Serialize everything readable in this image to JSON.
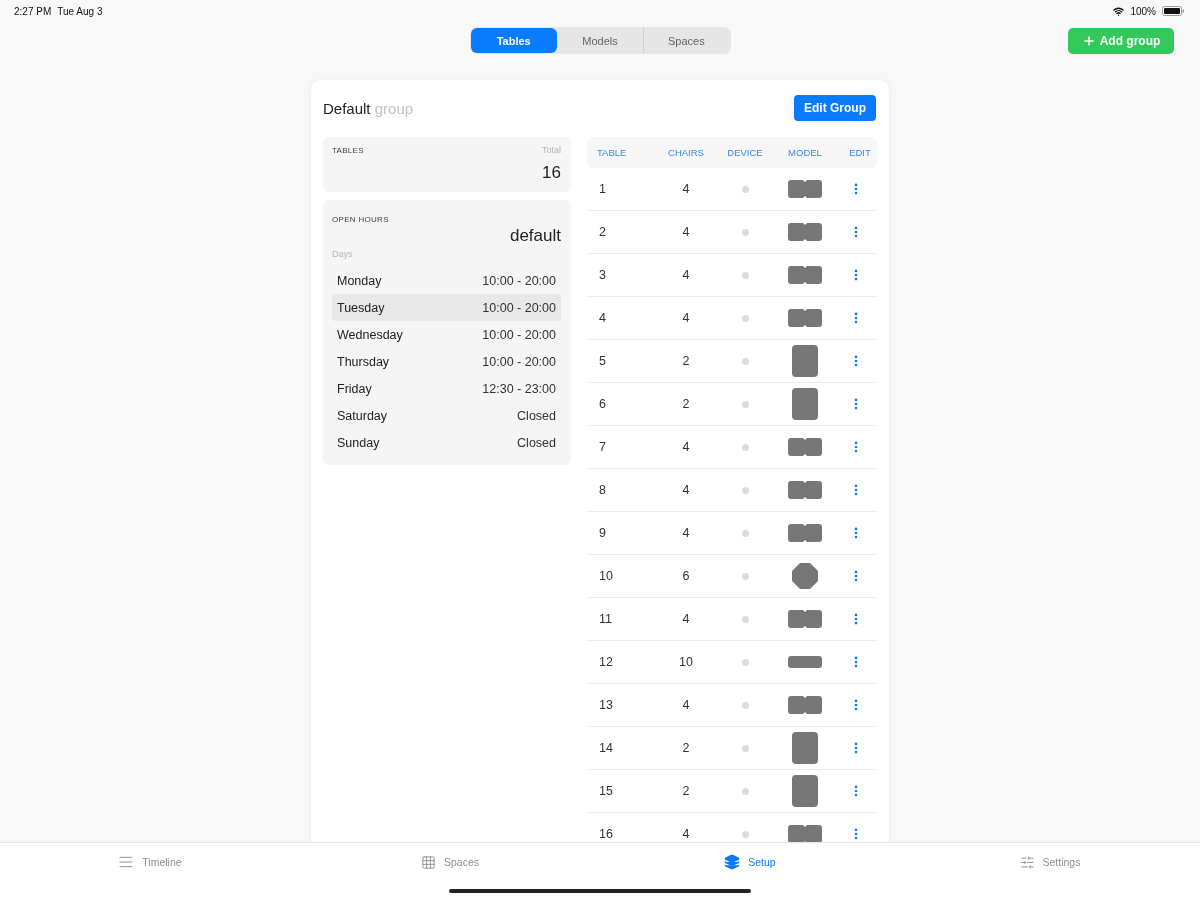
{
  "status_bar": {
    "time": "2:27 PM",
    "date": "Tue Aug 3",
    "battery": "100%"
  },
  "segments": [
    {
      "label": "Tables",
      "selected": true
    },
    {
      "label": "Models",
      "selected": false
    },
    {
      "label": "Spaces",
      "selected": false
    }
  ],
  "add_button": {
    "label": "Add group"
  },
  "group": {
    "name": "Default",
    "suffix": "group",
    "edit_button": "Edit Group"
  },
  "tables_panel": {
    "title": "TABLES",
    "total_label": "Total",
    "total": "16"
  },
  "open_hours": {
    "title": "OPEN HOURS",
    "schedule": "default",
    "days_label": "Days",
    "days": [
      {
        "day": "Monday",
        "hours": "10:00 - 20:00",
        "selected": false
      },
      {
        "day": "Tuesday",
        "hours": "10:00 - 20:00",
        "selected": true
      },
      {
        "day": "Wednesday",
        "hours": "10:00 - 20:00",
        "selected": false
      },
      {
        "day": "Thursday",
        "hours": "10:00 - 20:00",
        "selected": false
      },
      {
        "day": "Friday",
        "hours": "12:30 - 23:00",
        "selected": false
      },
      {
        "day": "Saturday",
        "hours": "Closed",
        "selected": false
      },
      {
        "day": "Sunday",
        "hours": "Closed",
        "selected": false
      }
    ]
  },
  "table": {
    "columns": [
      "TABLE",
      "CHAIRS",
      "DEVICE",
      "MODEL",
      "EDIT"
    ],
    "rows": [
      {
        "table": "1",
        "chairs": "4",
        "kind": "double"
      },
      {
        "table": "2",
        "chairs": "4",
        "kind": "double"
      },
      {
        "table": "3",
        "chairs": "4",
        "kind": "double"
      },
      {
        "table": "4",
        "chairs": "4",
        "kind": "double"
      },
      {
        "table": "5",
        "chairs": "2",
        "kind": "tall"
      },
      {
        "table": "6",
        "chairs": "2",
        "kind": "tall"
      },
      {
        "table": "7",
        "chairs": "4",
        "kind": "double"
      },
      {
        "table": "8",
        "chairs": "4",
        "kind": "double"
      },
      {
        "table": "9",
        "chairs": "4",
        "kind": "double"
      },
      {
        "table": "10",
        "chairs": "6",
        "kind": "round"
      },
      {
        "table": "11",
        "chairs": "4",
        "kind": "double"
      },
      {
        "table": "12",
        "chairs": "10",
        "kind": "long"
      },
      {
        "table": "13",
        "chairs": "4",
        "kind": "double"
      },
      {
        "table": "14",
        "chairs": "2",
        "kind": "tall"
      },
      {
        "table": "15",
        "chairs": "2",
        "kind": "tall"
      },
      {
        "table": "16",
        "chairs": "4",
        "kind": "double"
      }
    ]
  },
  "tab_bar": [
    {
      "label": "Timeline",
      "kind": "list",
      "selected": false
    },
    {
      "label": "Spaces",
      "kind": "grid",
      "selected": false
    },
    {
      "label": "Setup",
      "kind": "stack",
      "selected": true
    },
    {
      "label": "Settings",
      "kind": "sliders",
      "selected": false
    }
  ]
}
